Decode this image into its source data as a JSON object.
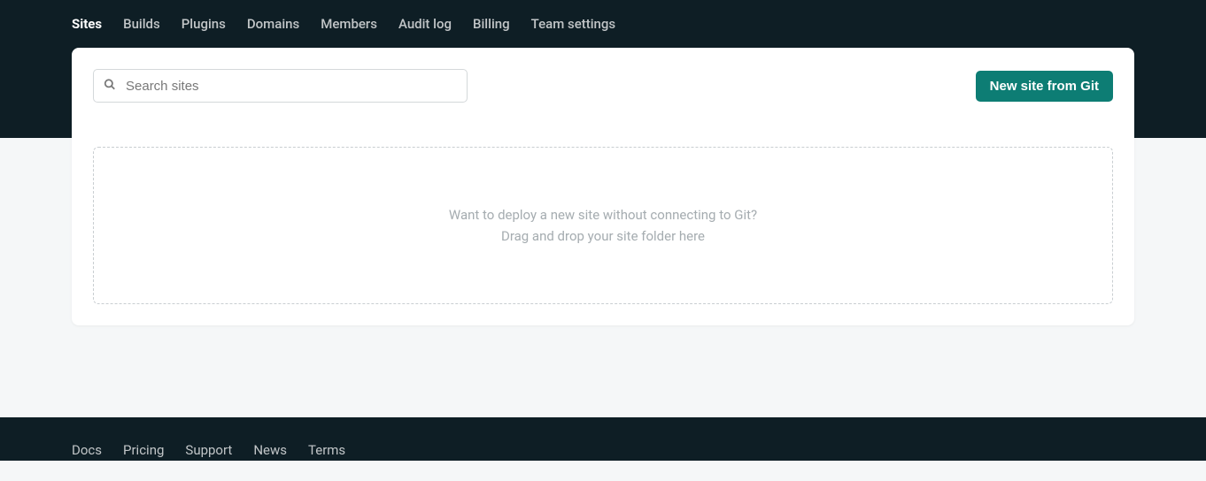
{
  "nav": {
    "tabs": [
      {
        "label": "Sites",
        "active": true
      },
      {
        "label": "Builds",
        "active": false
      },
      {
        "label": "Plugins",
        "active": false
      },
      {
        "label": "Domains",
        "active": false
      },
      {
        "label": "Members",
        "active": false
      },
      {
        "label": "Audit log",
        "active": false
      },
      {
        "label": "Billing",
        "active": false
      },
      {
        "label": "Team settings",
        "active": false
      }
    ]
  },
  "search": {
    "placeholder": "Search sites",
    "value": ""
  },
  "actions": {
    "new_site_label": "New site from Git"
  },
  "dropzone": {
    "line1": "Want to deploy a new site without connecting to Git?",
    "line2": "Drag and drop your site folder here"
  },
  "footer": {
    "links": [
      {
        "label": "Docs"
      },
      {
        "label": "Pricing"
      },
      {
        "label": "Support"
      },
      {
        "label": "News"
      },
      {
        "label": "Terms"
      }
    ]
  }
}
